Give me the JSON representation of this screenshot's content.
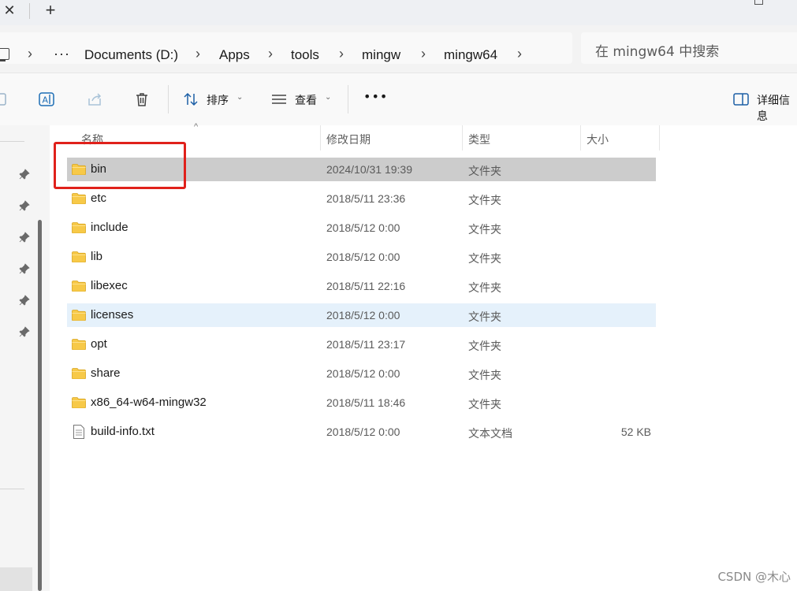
{
  "window": {
    "close_glyph": "✕",
    "new_tab_glyph": "+"
  },
  "breadcrumb": {
    "more": "···",
    "items": [
      "Documents (D:)",
      "Apps",
      "tools",
      "mingw",
      "mingw64"
    ]
  },
  "search": {
    "placeholder": "在 mingw64 中搜索"
  },
  "toolbar": {
    "sort_label": "排序",
    "view_label": "查看",
    "more_label": "•••",
    "details_label": "详细信息"
  },
  "columns": {
    "name": "名称",
    "modified": "修改日期",
    "type": "类型",
    "size": "大小"
  },
  "files": [
    {
      "name": "bin",
      "modified": "2024/10/31 19:39",
      "type": "文件夹",
      "size": "",
      "kind": "folder",
      "state": "selected"
    },
    {
      "name": "etc",
      "modified": "2018/5/11 23:36",
      "type": "文件夹",
      "size": "",
      "kind": "folder",
      "state": ""
    },
    {
      "name": "include",
      "modified": "2018/5/12 0:00",
      "type": "文件夹",
      "size": "",
      "kind": "folder",
      "state": ""
    },
    {
      "name": "lib",
      "modified": "2018/5/12 0:00",
      "type": "文件夹",
      "size": "",
      "kind": "folder",
      "state": ""
    },
    {
      "name": "libexec",
      "modified": "2018/5/11 22:16",
      "type": "文件夹",
      "size": "",
      "kind": "folder",
      "state": ""
    },
    {
      "name": "licenses",
      "modified": "2018/5/12 0:00",
      "type": "文件夹",
      "size": "",
      "kind": "folder",
      "state": "hover"
    },
    {
      "name": "opt",
      "modified": "2018/5/11 23:17",
      "type": "文件夹",
      "size": "",
      "kind": "folder",
      "state": ""
    },
    {
      "name": "share",
      "modified": "2018/5/12 0:00",
      "type": "文件夹",
      "size": "",
      "kind": "folder",
      "state": ""
    },
    {
      "name": "x86_64-w64-mingw32",
      "modified": "2018/5/11 18:46",
      "type": "文件夹",
      "size": "",
      "kind": "folder",
      "state": ""
    },
    {
      "name": "build-info.txt",
      "modified": "2018/5/12 0:00",
      "type": "文本文档",
      "size": "52 KB",
      "kind": "file",
      "state": ""
    }
  ],
  "watermark": "CSDN @木心",
  "colors": {
    "annotation": "#e0211b",
    "folder": "#f7c948",
    "selected_row": "#cccccc",
    "hover_row": "#e5f1fb"
  }
}
